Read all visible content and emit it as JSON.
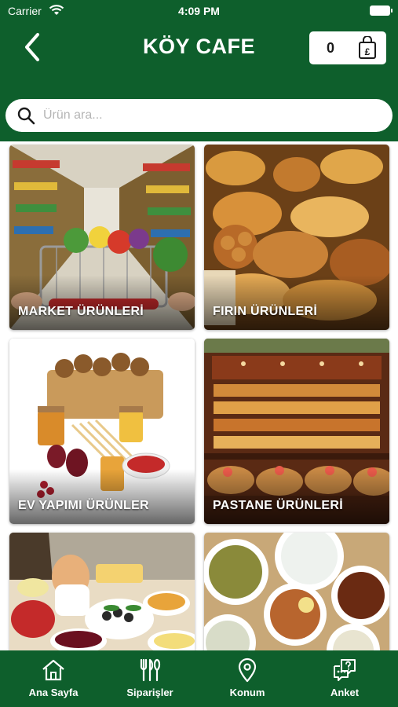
{
  "status_bar": {
    "carrier": "Carrier",
    "time": "4:09 PM"
  },
  "header": {
    "title": "KÖY CAFE",
    "cart_count": "0",
    "cart_currency_symbol": "£"
  },
  "search": {
    "placeholder": "Ürün ara...",
    "value": ""
  },
  "categories": [
    {
      "label": "MARKET ÜRÜNLERİ"
    },
    {
      "label": "FIRIN ÜRÜNLERİ"
    },
    {
      "label": "EV YAPIMI ÜRÜNLER"
    },
    {
      "label": "PASTANE ÜRÜNLERİ"
    },
    {
      "label": ""
    },
    {
      "label": ""
    }
  ],
  "tab_bar": {
    "items": [
      {
        "label": "Ana Sayfa",
        "icon": "home-icon"
      },
      {
        "label": "Siparişler",
        "icon": "cutlery-icon"
      },
      {
        "label": "Konum",
        "icon": "location-pin-icon"
      },
      {
        "label": "Anket",
        "icon": "survey-chat-icon"
      }
    ]
  },
  "colors": {
    "brand_green": "#0e5f2c",
    "surface": "#ffffff",
    "placeholder": "#b5b5b5"
  }
}
